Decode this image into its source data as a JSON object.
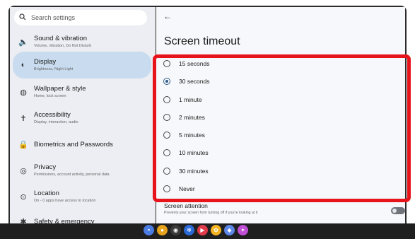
{
  "search": {
    "placeholder": "Search settings"
  },
  "sidebar": {
    "items": [
      {
        "title": "Sound & vibration",
        "subtitle": "Volume, vibration, Do Not Disturb",
        "icon": "speaker-icon"
      },
      {
        "title": "Display",
        "subtitle": "Brightness, Night Light",
        "icon": "brightness-icon",
        "active": true
      },
      {
        "title": "Wallpaper & style",
        "subtitle": "Home, lock screen",
        "icon": "palette-icon"
      },
      {
        "title": "Accessibility",
        "subtitle": "Display, interaction, audio",
        "icon": "accessibility-icon"
      },
      {
        "title": "Biometrics and Passwords",
        "subtitle": "",
        "icon": "lock-icon"
      },
      {
        "title": "Privacy",
        "subtitle": "Permissions, account activity, personal data",
        "icon": "privacy-icon"
      },
      {
        "title": "Location",
        "subtitle": "On - 0 apps have access to location",
        "icon": "location-pin-icon"
      },
      {
        "title": "Safety & emergency",
        "subtitle": "",
        "icon": "safety-icon"
      }
    ]
  },
  "main": {
    "back_icon": "back-arrow-icon",
    "title": "Screen timeout",
    "options": [
      {
        "label": "15 seconds",
        "checked": false
      },
      {
        "label": "30 seconds",
        "checked": true
      },
      {
        "label": "1 minute",
        "checked": false
      },
      {
        "label": "2 minutes",
        "checked": false
      },
      {
        "label": "5 minutes",
        "checked": false
      },
      {
        "label": "10 minutes",
        "checked": false
      },
      {
        "label": "30 minutes",
        "checked": false
      },
      {
        "label": "Never",
        "checked": false
      }
    ],
    "screen_attention": {
      "title": "Screen attention",
      "subtitle": "Prevents your screen from turning off if you're looking at it",
      "enabled": false
    }
  },
  "highlight_color": "#e8141c",
  "accent_color": "#2f5d8a",
  "dock": {
    "apps": [
      {
        "icon": "launcher-icon",
        "color": "#4a7be0"
      },
      {
        "icon": "chrome-icon",
        "color": "#e5a21b"
      },
      {
        "icon": "camera-icon",
        "color": "#3a3a3a"
      },
      {
        "icon": "settings-icon",
        "color": "#2a6ad8"
      },
      {
        "icon": "play-store-icon",
        "color": "#e03b4a"
      },
      {
        "icon": "photos-icon",
        "color": "#f3b323"
      },
      {
        "icon": "files-icon",
        "color": "#5c86e8"
      },
      {
        "icon": "assistant-icon",
        "color": "#c04fd6"
      }
    ]
  }
}
